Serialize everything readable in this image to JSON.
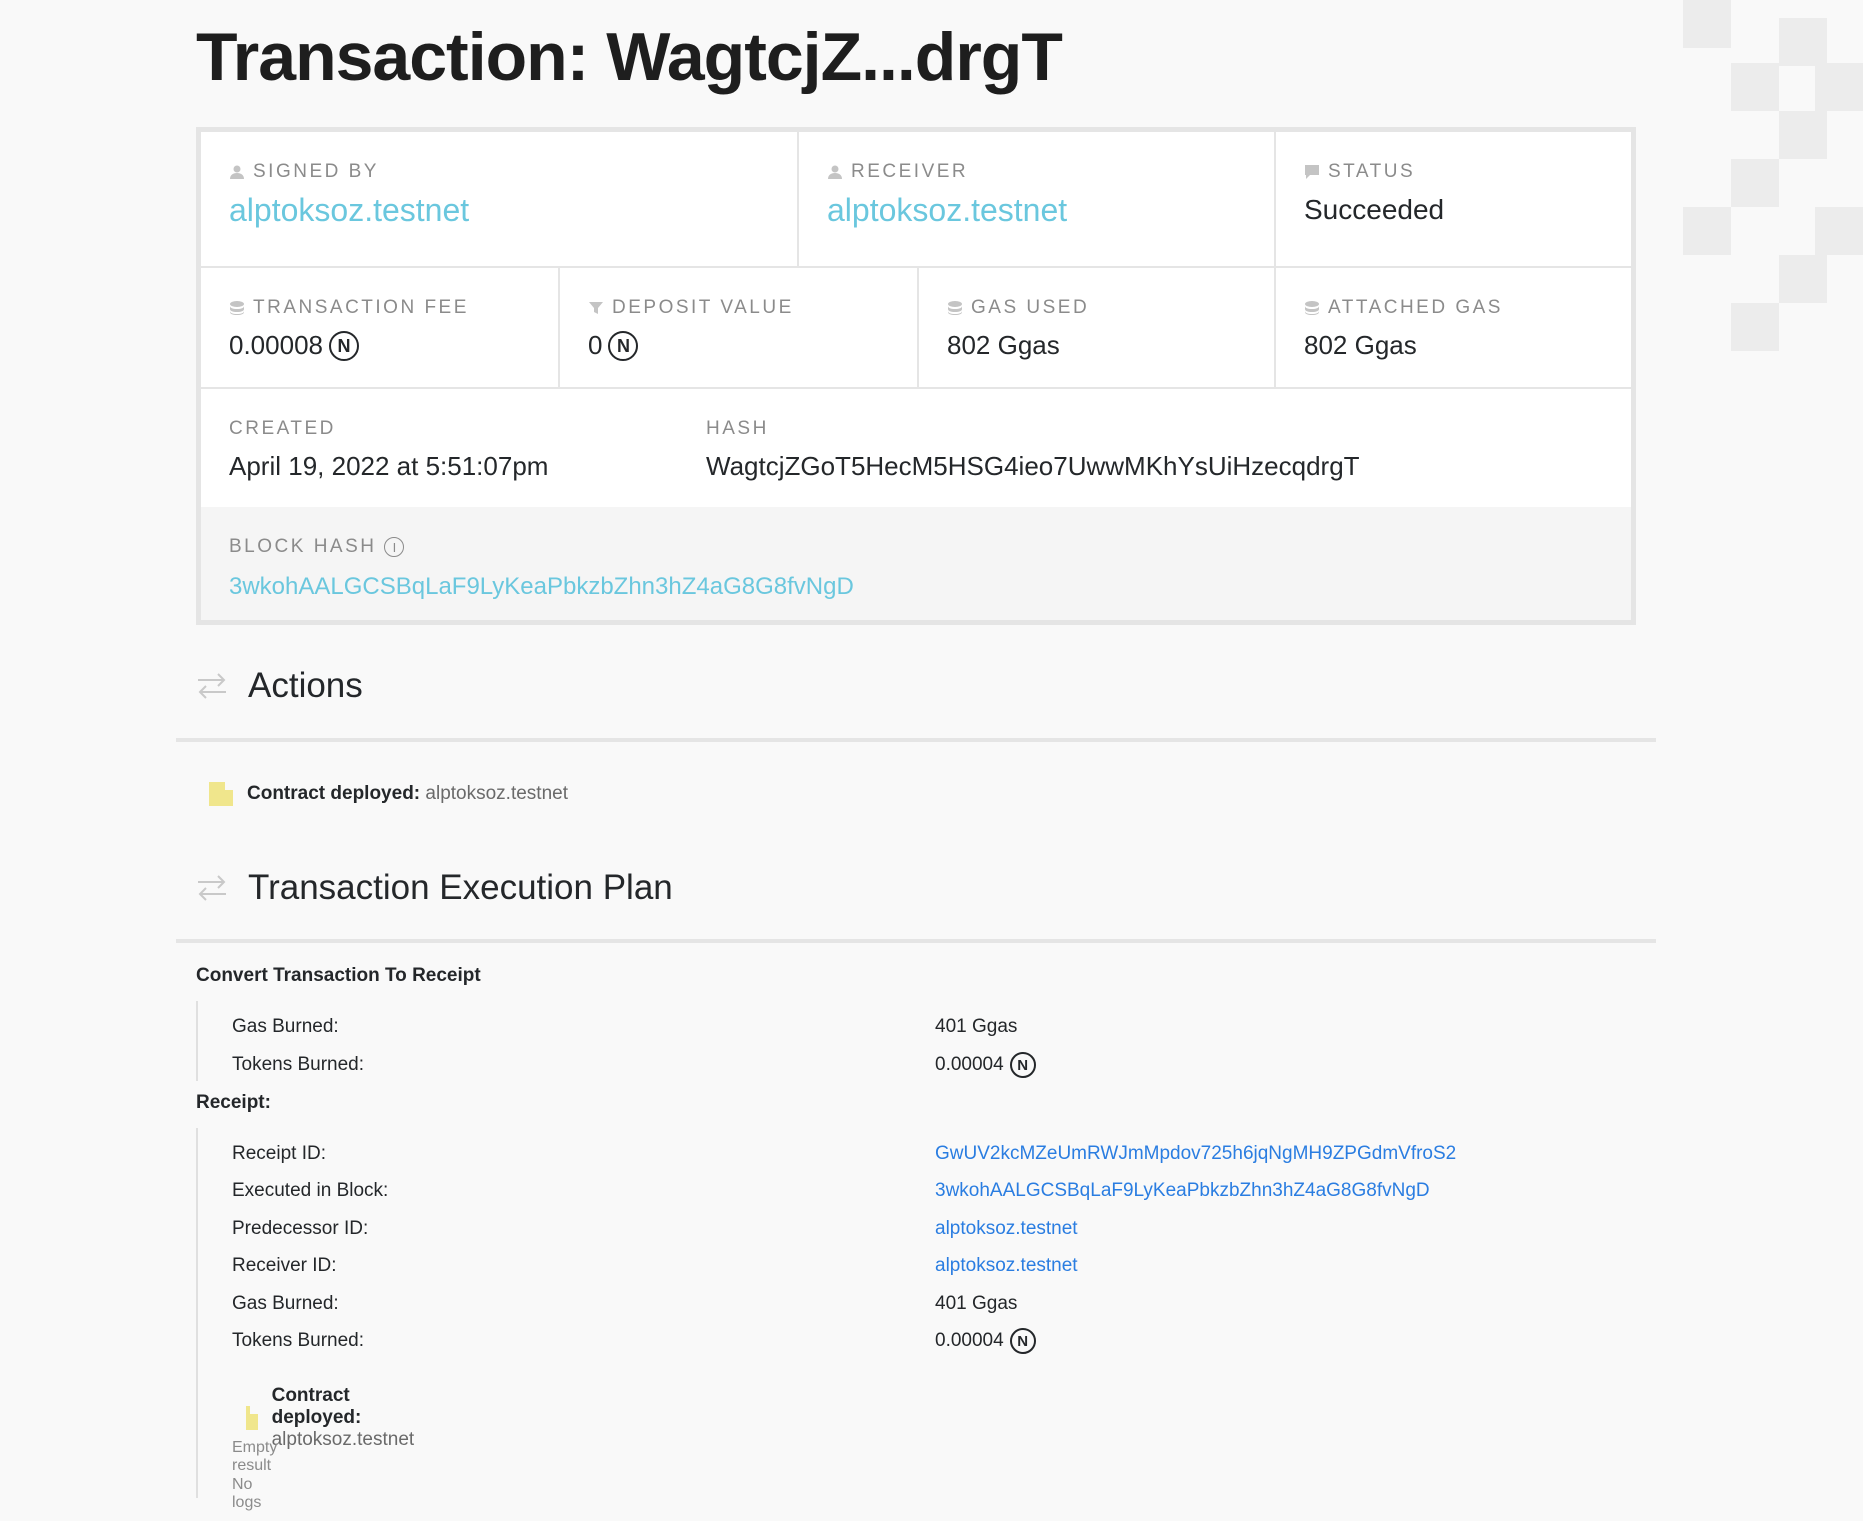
{
  "page": {
    "title": "Transaction: WagtcjZ...drgT"
  },
  "summary": {
    "signed_by": {
      "label": "SIGNED BY",
      "value": "alptoksoz.testnet"
    },
    "receiver": {
      "label": "RECEIVER",
      "value": "alptoksoz.testnet"
    },
    "status": {
      "label": "STATUS",
      "value": "Succeeded"
    },
    "transaction_fee": {
      "label": "TRANSACTION FEE",
      "value": "0.00008"
    },
    "deposit_value": {
      "label": "DEPOSIT VALUE",
      "value": "0"
    },
    "gas_used": {
      "label": "GAS USED",
      "value": "802 Ggas"
    },
    "attached_gas": {
      "label": "ATTACHED GAS",
      "value": "802 Ggas"
    },
    "created": {
      "label": "CREATED",
      "value": "April 19, 2022 at 5:51:07pm"
    },
    "hash": {
      "label": "HASH",
      "value": "WagtcjZGoT5HecM5HSG4ieo7UwwMKhYsUiHzecqdrgT"
    },
    "block_hash": {
      "label": "BLOCK HASH",
      "value": "3wkohAALGCSBqLaF9LyKeaPbkzbZhn3hZ4aG8G8fvNgD"
    },
    "near_symbol": "N",
    "info_symbol": "i"
  },
  "actions": {
    "heading": "Actions",
    "item": {
      "label": "Contract deployed:",
      "value": "alptoksoz.testnet"
    }
  },
  "plan": {
    "heading": "Transaction Execution Plan",
    "convert": {
      "title": "Convert Transaction To Receipt",
      "gas_burned": {
        "label": "Gas Burned:",
        "value": "401 Ggas"
      },
      "tokens_burned": {
        "label": "Tokens Burned:",
        "value": "0.00004"
      }
    },
    "receipt": {
      "title": "Receipt:",
      "receipt_id": {
        "label": "Receipt ID:",
        "value": "GwUV2kcMZeUmRWJmMpdov725h6jqNgMH9ZPGdmVfroS2"
      },
      "executed_in_block": {
        "label": "Executed in Block:",
        "value": "3wkohAALGCSBqLaF9LyKeaPbkzbZhn3hZ4aG8G8fvNgD"
      },
      "predecessor_id": {
        "label": "Predecessor ID:",
        "value": "alptoksoz.testnet"
      },
      "receiver_id": {
        "label": "Receiver ID:",
        "value": "alptoksoz.testnet"
      },
      "gas_burned": {
        "label": "Gas Burned:",
        "value": "401 Ggas"
      },
      "tokens_burned": {
        "label": "Tokens Burned:",
        "value": "0.00004"
      },
      "action": {
        "label": "Contract deployed:",
        "value": "alptoksoz.testnet"
      },
      "result": "Empty result",
      "logs": "No logs"
    }
  },
  "colors": {
    "link_light": "#6ac7de",
    "link_blue": "#2a7de1",
    "doc_icon": "#f0e68c",
    "border": "#e5e5e5"
  }
}
